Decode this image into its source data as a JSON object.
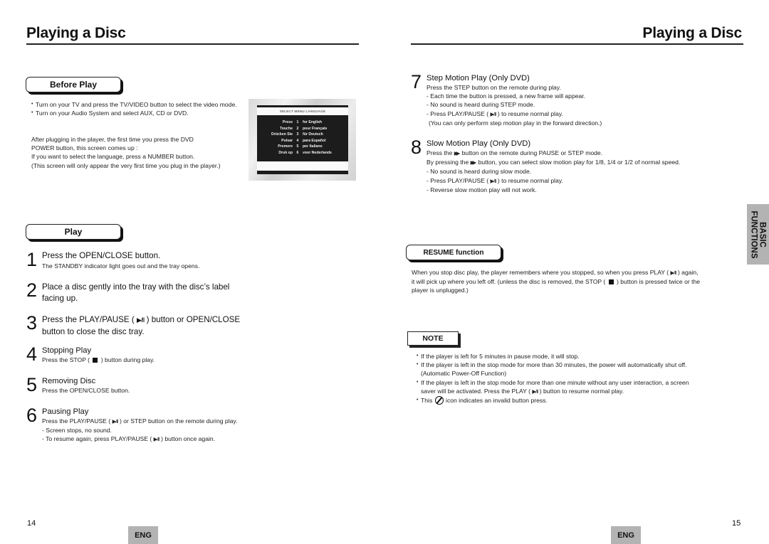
{
  "left_page": {
    "title": "Playing a Disc",
    "page_number": "14",
    "lang_badge": "ENG",
    "before_play": {
      "label": "Before Play",
      "bullets": [
        "Turn on your TV and press the TV/VIDEO button to select the video mode.",
        "Turn on your Audio System and select AUX, CD or DVD."
      ],
      "paragraph": [
        "After plugging in the player, the first time you press the DVD",
        "POWER button, this screen comes up :",
        "If you want to select the language, press a NUMBER button.",
        "(This screen will only appear the very first time you plug in the player.)"
      ],
      "language_screen": {
        "header": "SELECT MENU LANGUAGE",
        "rows": [
          {
            "prompt": "Press",
            "number": "1",
            "language": "for English"
          },
          {
            "prompt": "Touche",
            "number": "2",
            "language": "pour Français"
          },
          {
            "prompt": "Drücken Sie",
            "number": "3",
            "language": "für Deutsch"
          },
          {
            "prompt": "Pulsar",
            "number": "4",
            "language": "para Español"
          },
          {
            "prompt": "Premere",
            "number": "5",
            "language": "per Italiano"
          },
          {
            "prompt": "Druk op",
            "number": "6",
            "language": "voor Nederlands"
          }
        ]
      }
    },
    "play": {
      "label": "Play",
      "steps": [
        {
          "number": "1",
          "heading": "Press the OPEN/CLOSE button.",
          "lines": [
            "The STANDBY indicator light goes out and the tray opens."
          ]
        },
        {
          "number": "2",
          "heading_lines": [
            "Place a disc gently into the tray with the disc’s label",
            "facing up."
          ]
        },
        {
          "number": "3",
          "heading_pre": "Press the PLAY/PAUSE (",
          "heading_post": ") button or OPEN/CLOSE",
          "heading_line2": "button to close the disc tray."
        },
        {
          "number": "4",
          "heading": "Stopping Play",
          "line_pre": "Press the STOP (",
          "line_post": ") button during play."
        },
        {
          "number": "5",
          "heading": "Removing Disc",
          "lines": [
            "Press the OPEN/CLOSE button."
          ]
        },
        {
          "number": "6",
          "heading": "Pausing Play",
          "line1_pre": "Press the PLAY/PAUSE (",
          "line1_post": ") or STEP button on the remote during play.",
          "line2": "- Screen stops, no sound.",
          "line3_pre": "- To resume again, press PLAY/PAUSE (",
          "line3_post": ") button once again."
        }
      ]
    }
  },
  "right_page": {
    "title": "Playing a Disc",
    "page_number": "15",
    "lang_badge": "ENG",
    "side_tab": {
      "line1": "BASIC",
      "line2": "FUNCTIONS"
    },
    "steps": [
      {
        "number": "7",
        "heading": "Step Motion Play (Only DVD)",
        "line1": "Press the STEP button on the remote during play.",
        "line2": "- Each time the button is pressed, a new frame will appear.",
        "line3": "- No sound is heard during STEP mode.",
        "line4_pre": "- Press PLAY/PAUSE (",
        "line4_post": ") to resume normal play.",
        "line5": "(You can only perform step motion play in the forward direction.)"
      },
      {
        "number": "8",
        "heading": "Slow Motion Play (Only DVD)",
        "line1_pre": "Press the",
        "line1_post": "button on the remote during PAUSE or STEP mode.",
        "line2_pre": "By pressing the",
        "line2_post": "button, you can select slow motion play for 1/8, 1/4 or 1/2 of normal speed.",
        "line3": "- No sound is heard during slow mode.",
        "line4_pre": "- Press PLAY/PAUSE (",
        "line4_post": ") to resume normal play.",
        "line5": "- Reverse slow motion play will not work."
      }
    ],
    "resume": {
      "label": "RESUME function",
      "line1_pre": "When you stop disc play, the player remembers where you stopped, so when you press PLAY (",
      "line1_post": ") again,",
      "line2_pre": "it will pick up where you left off. (unless the disc is removed, the STOP (",
      "line2_post": ") button is pressed twice or the",
      "line3": "player is unplugged.)"
    },
    "note": {
      "label": "NOTE",
      "b1": "If the player is left for 5 minutes in pause mode, it will stop.",
      "b2_line1": "If the player is left in the stop mode for more than 30 minutes, the power will automatically shut off.",
      "b2_line2": "(Automatic Power-Off Function)",
      "b3_line1": "If the player is left in the stop mode for more than one minute without any user interaction, a screen",
      "b3_line2_pre": "saver will be activated. Press the PLAY (",
      "b3_line2_post": ") button to resume normal play.",
      "b4_pre": "This",
      "b4_post": "icon indicates an invalid button press."
    }
  },
  "icons": {
    "play_pause": "▶/II",
    "fast_forward": "▶▶"
  }
}
